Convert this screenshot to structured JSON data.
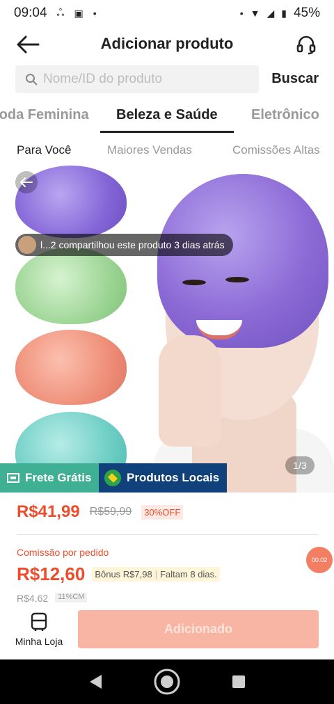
{
  "status_bar": {
    "time": "09:04",
    "battery": "45%"
  },
  "header": {
    "title": "Adicionar produto"
  },
  "search": {
    "placeholder": "Nome/ID do produto",
    "button_label": "Buscar"
  },
  "category_tabs": [
    {
      "label": "Moda Feminina",
      "active": false
    },
    {
      "label": "Beleza e Saúde",
      "active": true
    },
    {
      "label": "Eletrônico",
      "active": false
    }
  ],
  "sub_tabs": [
    {
      "label": "Para Você",
      "active": true
    },
    {
      "label": "Maiores Vendas",
      "active": false
    },
    {
      "label": "Comissões Altas",
      "active": false
    }
  ],
  "product": {
    "share_notice": "l...2 compartilhou este produto 3 dias atrás",
    "page_indicator": "1/3",
    "badge_free_shipping": "Frete Grátis",
    "badge_local": "Produtos Locais",
    "price": "R$41,99",
    "old_price": "R$59,99",
    "discount": "30%OFF",
    "commission_label": "Comissão por pedido",
    "commission_value": "R$12,60",
    "bonus": "Bônus R$7,98",
    "bonus_remaining": "Faltam 8 dias.",
    "partial_value": "R$4,62",
    "partial_percent": "11%CM",
    "timer": "00:02"
  },
  "bottom": {
    "store_label": "Minha Loja",
    "add_button_label": "Adicionado"
  },
  "colors": {
    "accent": "#ee4d2d",
    "free_shipping": "#3fb094",
    "local": "#10417a",
    "added_button": "#f9b5a3"
  },
  "icons": [
    "back-arrow-icon",
    "headset-icon",
    "search-icon",
    "truck-icon",
    "brazil-flag-icon",
    "store-icon",
    "nav-back-icon",
    "nav-home-icon",
    "nav-recents-icon"
  ]
}
